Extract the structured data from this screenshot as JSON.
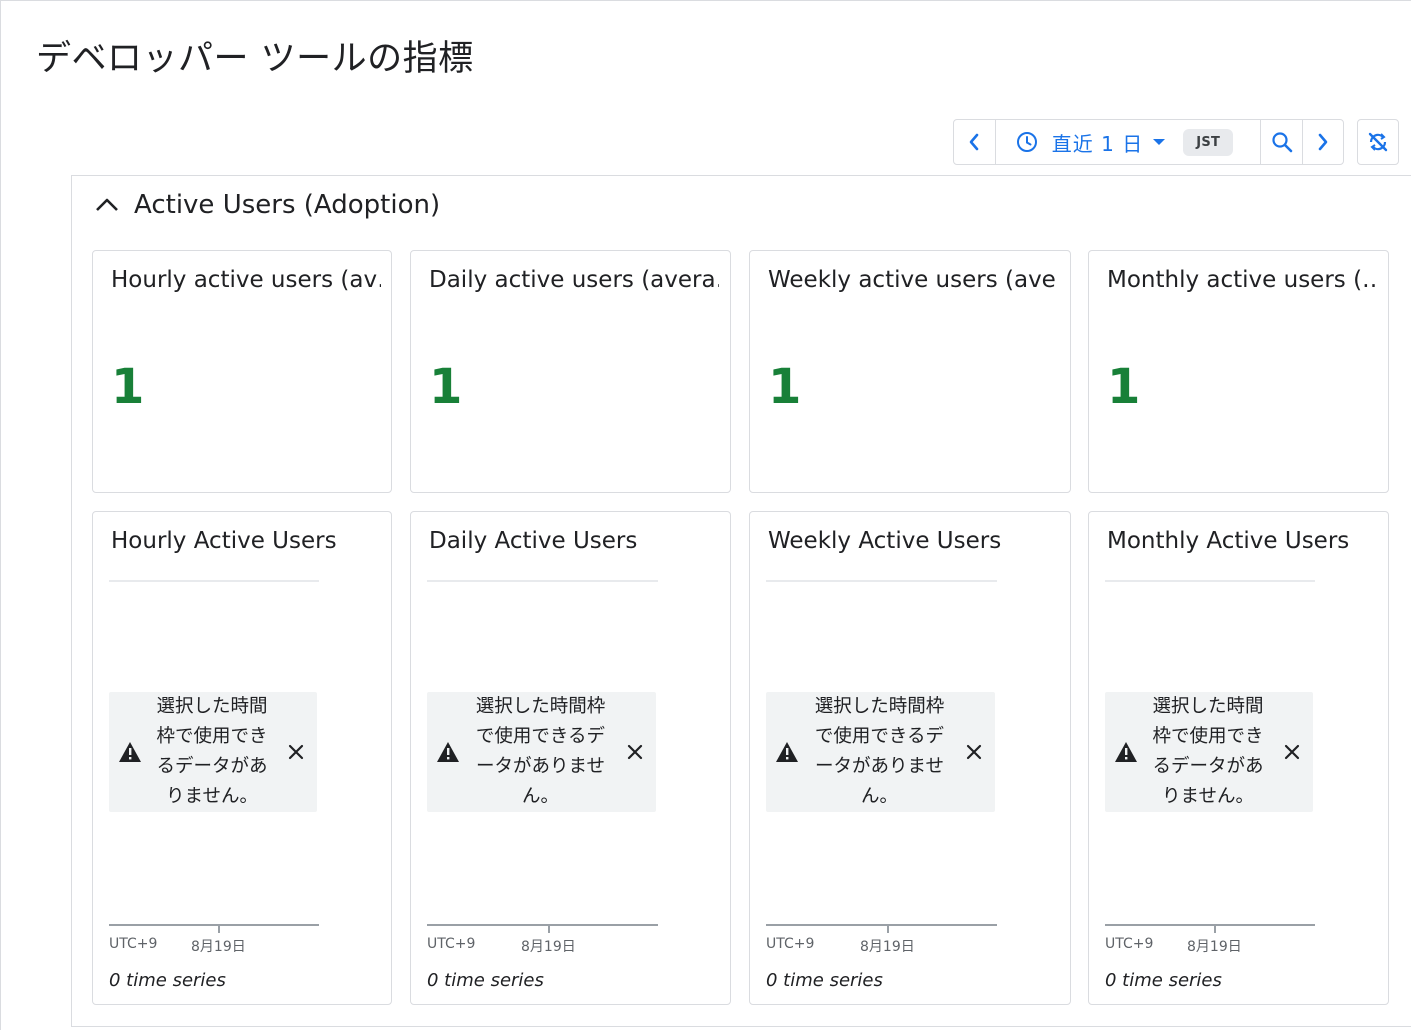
{
  "page": {
    "title": "デベロッパー ツールの指標"
  },
  "toolbar": {
    "range_label": "直近 1 日",
    "timezone": "JST",
    "icons": [
      "chevron-left-icon",
      "clock-icon",
      "caret-down-icon",
      "zoom-in-icon",
      "chevron-right-icon",
      "sync-off-icon"
    ],
    "accent_color": "#1a73e8"
  },
  "section": {
    "title": "Active Users (Adoption)",
    "expanded": true
  },
  "scorecards": [
    {
      "title": "Hourly active users (av…",
      "value": "1"
    },
    {
      "title": "Daily active users (avera…",
      "value": "1"
    },
    {
      "title": "Weekly active users (ave…",
      "value": "1"
    },
    {
      "title": "Monthly active users (…",
      "value": "1"
    }
  ],
  "charts": [
    {
      "title": "Hourly Active Users",
      "message": "選択した時間枠で使用できるデータがありません。",
      "axis_tz": "UTC+9",
      "axis_date": "8月19日",
      "series": "0 time series"
    },
    {
      "title": "Daily Active Users",
      "message": "選択した時間枠で使用できるデータがありません。",
      "axis_tz": "UTC+9",
      "axis_date": "8月19日",
      "series": "0 time series"
    },
    {
      "title": "Weekly Active Users",
      "message": "選択した時間枠で使用できるデータがありません。",
      "axis_tz": "UTC+9",
      "axis_date": "8月19日",
      "series": "0 time series"
    },
    {
      "title": "Monthly Active Users",
      "message": "選択した時間枠で使用できるデータがありません。",
      "axis_tz": "UTC+9",
      "axis_date": "8月19日",
      "series": "0 time series"
    }
  ],
  "colors": {
    "value_green": "#188038",
    "border": "#dadce0",
    "nodata_bg": "#f1f3f4"
  }
}
